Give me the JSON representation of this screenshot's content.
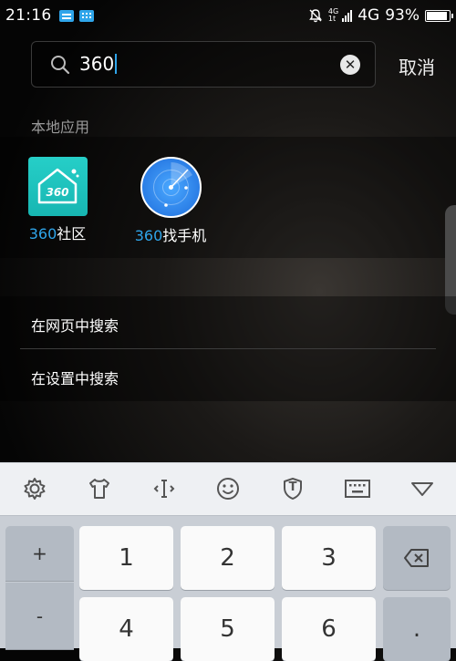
{
  "status_bar": {
    "time": "21:16",
    "net_small_top": "4G",
    "net_small_bottom": "1t",
    "network": "4G",
    "battery": "93%",
    "battery_level": 0.93
  },
  "search": {
    "query": "360",
    "cancel_label": "取消"
  },
  "local_apps": {
    "section_label": "本地应用",
    "items": [
      {
        "highlight": "360",
        "rest": "社区",
        "icon": "home-icon",
        "icon_text": "360"
      },
      {
        "highlight": "360",
        "rest": "找手机",
        "icon": "radar-icon"
      }
    ]
  },
  "web_search": {
    "items": [
      {
        "label": "在网页中搜索"
      },
      {
        "label": "在设置中搜索"
      }
    ]
  },
  "keyboard": {
    "toolbar_icons": [
      "gear-icon",
      "tshirt-icon",
      "cursor-move-icon",
      "smiley-icon",
      "shield-t-icon",
      "keyboard-icon",
      "collapse-triangle-icon"
    ],
    "shield_letter": "T",
    "side_keys": [
      "+",
      "-"
    ],
    "digit_keys": [
      "1",
      "2",
      "3",
      "4",
      "5",
      "6"
    ],
    "backspace_icon": "backspace-icon",
    "dot_key": "."
  }
}
